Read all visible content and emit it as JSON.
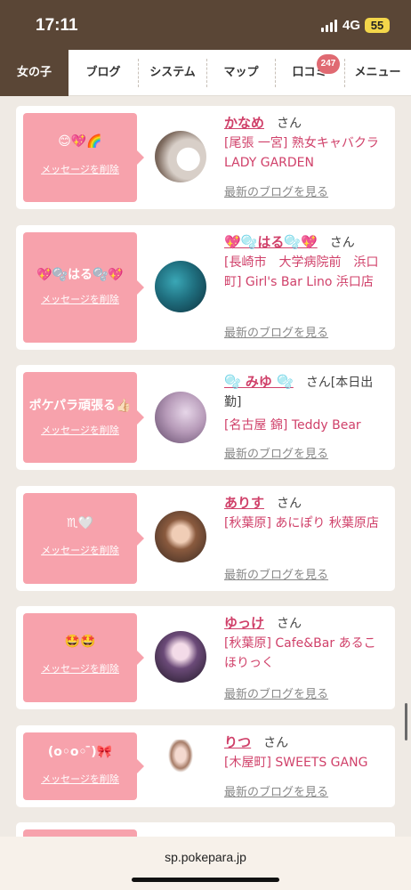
{
  "status_bar": {
    "time": "17:11",
    "network": "4G",
    "battery": "55"
  },
  "nav": {
    "tabs": [
      {
        "label": "女の子",
        "active": true
      },
      {
        "label": "ブログ"
      },
      {
        "label": "システム"
      },
      {
        "label": "マップ"
      },
      {
        "label": "口コミ",
        "badge": "247"
      },
      {
        "label": "メニュー"
      }
    ]
  },
  "cards": [
    {
      "message": "😊💖🌈",
      "delete_label": "メッセージを削除",
      "name": "かなめ",
      "suffix": "さん",
      "shop": "[尾張 一宮] 熟女キャバクラ LADY GARDEN",
      "blog_link": "最新のブログを見る"
    },
    {
      "message": "💖🫧はる🫧💖",
      "delete_label": "メッセージを削除",
      "name": "💖🫧はる🫧💖",
      "suffix": "さん",
      "shop": "[長崎市　大学病院前　浜口町] Girl's Bar Lino 浜口店",
      "blog_link": "最新のブログを見る"
    },
    {
      "message": "ポケパラ頑張る👍🏻",
      "delete_label": "メッセージを削除",
      "name": "🫧 みゆ 🫧",
      "suffix": "さん[本日出勤]",
      "shop": "[名古屋 錦] Teddy Bear",
      "blog_link": "最新のブログを見る"
    },
    {
      "message": "♏🤍",
      "delete_label": "メッセージを削除",
      "name": "ありす",
      "suffix": "さん",
      "shop": "[秋葉原] あにぽり 秋葉原店",
      "blog_link": "最新のブログを見る"
    },
    {
      "message": "🤩🤩",
      "delete_label": "メッセージを削除",
      "name": "ゆっけ",
      "suffix": "さん",
      "shop": "[秋葉原] Cafe&Bar あるこほりっく",
      "blog_link": "最新のブログを見る"
    },
    {
      "message": "(o◦o◦ ̄)🎀",
      "delete_label": "メッセージを削除",
      "name": "りつ",
      "suffix": "さん",
      "shop": "[木屋町] SWEETS GANG",
      "blog_link": "最新のブログを見る"
    },
    {
      "message": "",
      "delete_label": "",
      "name": "",
      "suffix": "",
      "shop": "",
      "blog_link": ""
    }
  ],
  "browser": {
    "url": "sp.pokepara.jp"
  }
}
